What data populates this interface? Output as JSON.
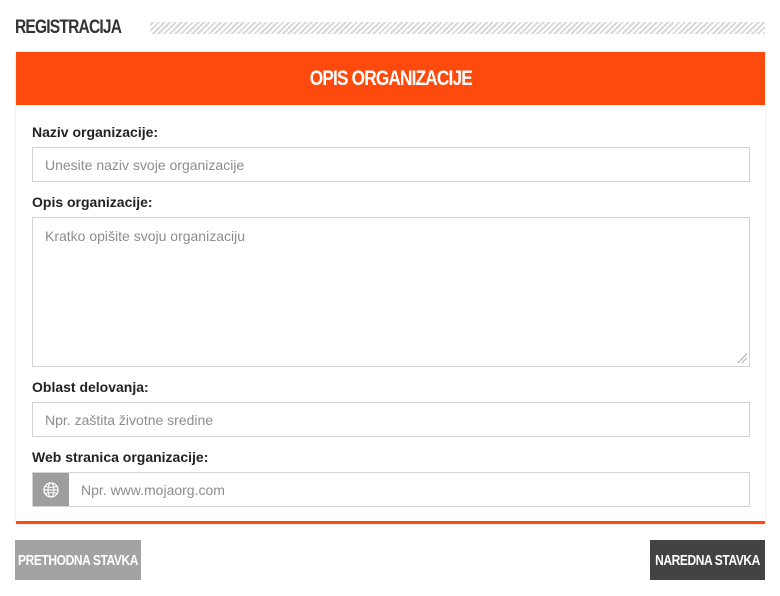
{
  "page": {
    "section_title": "REGISTRACIJA"
  },
  "card": {
    "title": "OPIS ORGANIZACIJE"
  },
  "form": {
    "name": {
      "label": "Naziv organizacije:",
      "placeholder": "Unesite naziv svoje organizacije",
      "value": ""
    },
    "description": {
      "label": "Opis organizacije:",
      "placeholder": "Kratko opišite svoju organizaciju",
      "value": ""
    },
    "field_of_work": {
      "label": "Oblast delovanja:",
      "placeholder": "Npr. zaštita životne sredine",
      "value": ""
    },
    "website": {
      "label": "Web stranica organizacije:",
      "placeholder": "Npr. www.mojaorg.com",
      "value": "",
      "addon_icon": "globe-icon"
    }
  },
  "navigation": {
    "prev_label": "PRETHODNA STAVKA",
    "next_label": "NAREDNA STAVKA"
  },
  "colors": {
    "accent": "#ff4a0d",
    "prev_button": "#a3a3a3",
    "next_button": "#434343",
    "addon_background": "#9e9e9e"
  }
}
